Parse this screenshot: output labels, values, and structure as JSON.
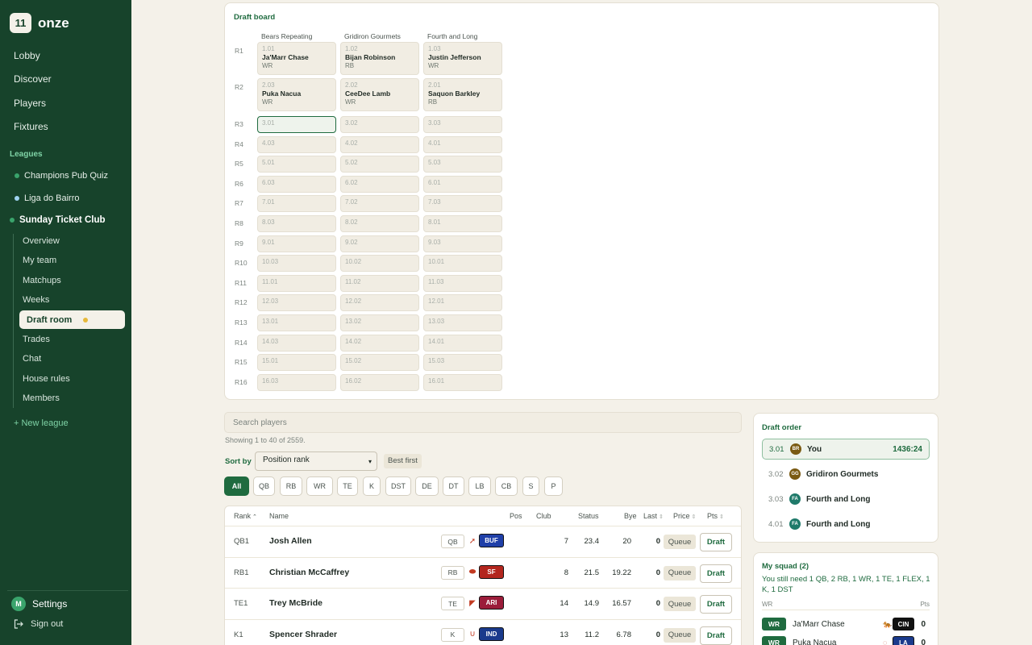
{
  "app": {
    "name": "onze",
    "logo_text": "11"
  },
  "nav": {
    "lobby": "Lobby",
    "discover": "Discover",
    "players": "Players",
    "fixtures": "Fixtures"
  },
  "leagues_label": "Leagues",
  "leagues": [
    {
      "name": "Champions Pub Quiz",
      "color": "#3aa46c"
    },
    {
      "name": "Liga do Bairro",
      "color": "#9fd3f0"
    },
    {
      "name": "Sunday Ticket Club",
      "color": "#3aa46c"
    }
  ],
  "subnav": [
    "Overview",
    "My team",
    "Matchups",
    "Weeks",
    "Draft room",
    "Trades",
    "Chat",
    "House rules",
    "Members"
  ],
  "new_league": "+ New league",
  "settings": {
    "avatar": "M",
    "label": "Settings"
  },
  "signout": "Sign out",
  "board": {
    "title": "Draft board",
    "teams": [
      "Bears Repeating",
      "Gridiron Gourmets",
      "Fourth and Long"
    ],
    "rounds": [
      {
        "label": "R1",
        "picks": [
          {
            "pick": "1.01",
            "player": "Ja'Marr Chase",
            "pos": "WR"
          },
          {
            "pick": "1.02",
            "player": "Bijan Robinson",
            "pos": "RB"
          },
          {
            "pick": "1.03",
            "player": "Justin Jefferson",
            "pos": "WR"
          }
        ]
      },
      {
        "label": "R2",
        "picks": [
          {
            "pick": "2.03",
            "player": "Puka Nacua",
            "pos": "WR"
          },
          {
            "pick": "2.02",
            "player": "CeeDee Lamb",
            "pos": "WR"
          },
          {
            "pick": "2.01",
            "player": "Saquon Barkley",
            "pos": "RB"
          }
        ]
      },
      {
        "label": "R3",
        "picks": [
          {
            "pick": "3.01"
          },
          {
            "pick": "3.02"
          },
          {
            "pick": "3.03"
          }
        ]
      },
      {
        "label": "R4",
        "picks": [
          {
            "pick": "4.03"
          },
          {
            "pick": "4.02"
          },
          {
            "pick": "4.01"
          }
        ]
      },
      {
        "label": "R5",
        "picks": [
          {
            "pick": "5.01"
          },
          {
            "pick": "5.02"
          },
          {
            "pick": "5.03"
          }
        ]
      },
      {
        "label": "R6",
        "picks": [
          {
            "pick": "6.03"
          },
          {
            "pick": "6.02"
          },
          {
            "pick": "6.01"
          }
        ]
      },
      {
        "label": "R7",
        "picks": [
          {
            "pick": "7.01"
          },
          {
            "pick": "7.02"
          },
          {
            "pick": "7.03"
          }
        ]
      },
      {
        "label": "R8",
        "picks": [
          {
            "pick": "8.03"
          },
          {
            "pick": "8.02"
          },
          {
            "pick": "8.01"
          }
        ]
      },
      {
        "label": "R9",
        "picks": [
          {
            "pick": "9.01"
          },
          {
            "pick": "9.02"
          },
          {
            "pick": "9.03"
          }
        ]
      },
      {
        "label": "R10",
        "picks": [
          {
            "pick": "10.03"
          },
          {
            "pick": "10.02"
          },
          {
            "pick": "10.01"
          }
        ]
      },
      {
        "label": "R11",
        "picks": [
          {
            "pick": "11.01"
          },
          {
            "pick": "11.02"
          },
          {
            "pick": "11.03"
          }
        ]
      },
      {
        "label": "R12",
        "picks": [
          {
            "pick": "12.03"
          },
          {
            "pick": "12.02"
          },
          {
            "pick": "12.01"
          }
        ]
      },
      {
        "label": "R13",
        "picks": [
          {
            "pick": "13.01"
          },
          {
            "pick": "13.02"
          },
          {
            "pick": "13.03"
          }
        ]
      },
      {
        "label": "R14",
        "picks": [
          {
            "pick": "14.03"
          },
          {
            "pick": "14.02"
          },
          {
            "pick": "14.01"
          }
        ]
      },
      {
        "label": "R15",
        "picks": [
          {
            "pick": "15.01"
          },
          {
            "pick": "15.02"
          },
          {
            "pick": "15.03"
          }
        ]
      },
      {
        "label": "R16",
        "picks": [
          {
            "pick": "16.03"
          },
          {
            "pick": "16.02"
          },
          {
            "pick": "16.01"
          }
        ]
      }
    ]
  },
  "search": {
    "placeholder": "Search players",
    "value": ""
  },
  "showing": "Showing 1 to 40 of 2559.",
  "sort": {
    "label": "Sort by",
    "selected": "Position rank",
    "best_first": "Best first"
  },
  "filters": [
    "All",
    "QB",
    "RB",
    "WR",
    "TE",
    "K",
    "DST",
    "DE",
    "DT",
    "LB",
    "CB",
    "S",
    "P"
  ],
  "table": {
    "headers": {
      "rank": "Rank",
      "name": "Name",
      "pos": "Pos",
      "club": "Club",
      "status": "Status",
      "bye": "Bye",
      "last": "Last",
      "price": "Price",
      "pts": "Pts"
    },
    "rows": [
      {
        "rank": "QB1",
        "name": "Josh Allen",
        "pos": "QB",
        "club": "BUF",
        "club_color": "#1f3fa8",
        "icon": "buffalo-icon",
        "glyph": "➚",
        "bye": "7",
        "last": "23.4",
        "price": "20",
        "pts": "0",
        "queue": "Queue",
        "draft": "Draft"
      },
      {
        "rank": "RB1",
        "name": "Christian McCaffrey",
        "pos": "RB",
        "club": "SF",
        "club_color": "#b3261e",
        "icon": "sf-oval-icon",
        "glyph": "⬬",
        "bye": "8",
        "last": "21.5",
        "price": "19.22",
        "pts": "0",
        "queue": "Queue",
        "draft": "Draft"
      },
      {
        "rank": "TE1",
        "name": "Trey McBride",
        "pos": "TE",
        "club": "ARI",
        "club_color": "#9b1c3a",
        "icon": "cardinal-icon",
        "glyph": "◤",
        "bye": "14",
        "last": "14.9",
        "price": "16.57",
        "pts": "0",
        "queue": "Queue",
        "draft": "Draft"
      },
      {
        "rank": "K1",
        "name": "Spencer Shrader",
        "pos": "K",
        "club": "IND",
        "club_color": "#1a3a8c",
        "icon": "horseshoe-icon",
        "glyph": "∪",
        "bye": "13",
        "last": "11.2",
        "price": "6.78",
        "pts": "0",
        "queue": "Queue",
        "draft": "Draft"
      }
    ]
  },
  "draft_order": {
    "title": "Draft order",
    "items": [
      {
        "pick": "3.01",
        "badge": "BR",
        "badge_color": "#7a5a12",
        "name": "You",
        "timer": "1436:24"
      },
      {
        "pick": "3.02",
        "badge": "GG",
        "badge_color": "#7a5a12",
        "name": "Gridiron Gourmets"
      },
      {
        "pick": "3.03",
        "badge": "FA",
        "badge_color": "#1f7a6a",
        "name": "Fourth and Long"
      },
      {
        "pick": "4.01",
        "badge": "FA",
        "badge_color": "#1f7a6a",
        "name": "Fourth and Long"
      }
    ]
  },
  "squad": {
    "title": "My squad (2)",
    "need": "You still need 1 QB, 2 RB, 1 WR, 1 TE, 1 FLEX, 1 K, 1 DST",
    "col_pos": "WR",
    "col_pts": "Pts",
    "players": [
      {
        "pos": "WR",
        "name": "Ja'Marr Chase",
        "club": "CIN",
        "club_color": "#111111",
        "glyph": "🐅",
        "pts": "0"
      },
      {
        "pos": "WR",
        "name": "Puka Nacua",
        "club": "LA",
        "club_color": "#1a3a8c",
        "glyph": "◌",
        "pts": "0"
      }
    ]
  }
}
